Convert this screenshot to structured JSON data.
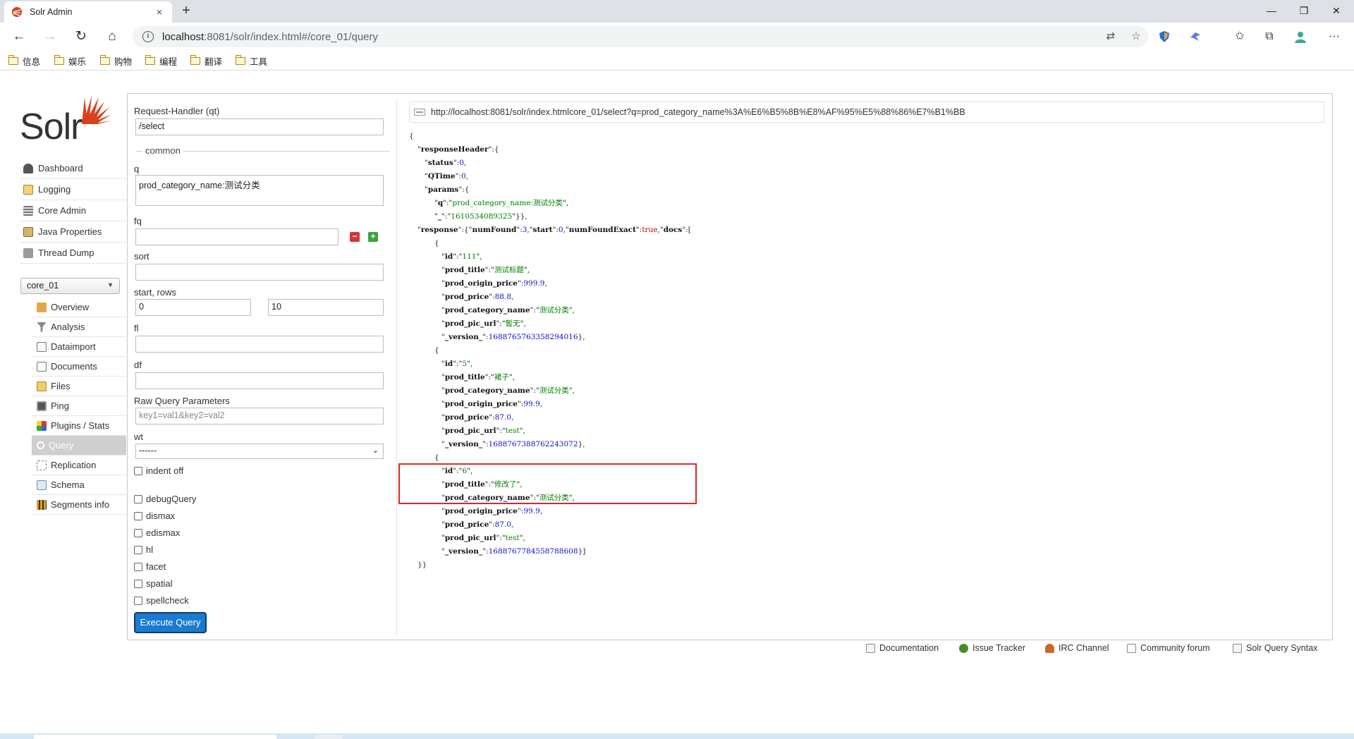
{
  "browser": {
    "tab_title": "Solr Admin",
    "tab_close": "×",
    "new_tab": "+",
    "win_min": "—",
    "win_max": "❐",
    "win_close": "✕",
    "back": "←",
    "forward": "→",
    "reload": "↻",
    "home": "⌂",
    "url_host": "localhost",
    "url_path": ":8081/solr/index.html#/core_01/query",
    "bookmarks": [
      "信息",
      "娱乐",
      "购物",
      "编程",
      "翻译",
      "工具"
    ]
  },
  "logo_text": "Solr",
  "nav": {
    "items": [
      "Dashboard",
      "Logging",
      "Core Admin",
      "Java Properties",
      "Thread Dump"
    ],
    "core_selected": "core_01",
    "core_items": [
      "Overview",
      "Analysis",
      "Dataimport",
      "Documents",
      "Files",
      "Ping",
      "Plugins / Stats",
      "Query",
      "Replication",
      "Schema",
      "Segments info"
    ]
  },
  "form": {
    "request_handler_label": "Request-Handler (qt)",
    "request_handler_value": "/select",
    "common_label": "common",
    "q_label": "q",
    "q_value": "prod_category_name:测试分类",
    "fq_label": "fq",
    "fq_value": "",
    "fq_remove": "−",
    "fq_add": "+",
    "sort_label": "sort",
    "sort_value": "",
    "start_rows_label": "start, rows",
    "start_value": "0",
    "rows_value": "10",
    "fl_label": "fl",
    "fl_value": "",
    "df_label": "df",
    "df_value": "",
    "raw_label": "Raw Query Parameters",
    "raw_placeholder": "key1=val1&key2=val2",
    "wt_label": "wt",
    "wt_value": "------",
    "indent_label": "indent off",
    "options": [
      "debugQuery",
      "dismax",
      "edismax",
      "hl",
      "facet",
      "spatial",
      "spellcheck"
    ],
    "execute_label": "Execute Query"
  },
  "result": {
    "request_url": "http://localhost:8081/solr/index.htmlcore_01/select?q=prod_category_name%3A%E6%B5%8B%E8%AF%95%E5%88%86%E7%B1%BB",
    "responseHeader": {
      "status": "0",
      "QTime": "0",
      "q": "prod_category_name:测试分类",
      "_": "1610534089325"
    },
    "numFound": "3",
    "start": "0",
    "numFoundExact": "true",
    "docs": [
      {
        "id": "111",
        "prod_title": "测试标题",
        "prod_origin_price": "999.9",
        "prod_price": "88.8",
        "prod_category_name": "测试分类",
        "prod_pic_url": "暂无",
        "_version_": "1688765763358294016"
      },
      {
        "id": "5",
        "prod_title": "裙子",
        "prod_category_name": "测试分类",
        "prod_origin_price": "99.9",
        "prod_price": "87.0",
        "prod_pic_url": "test",
        "_version_": "1688767388762243072"
      },
      {
        "id": "6",
        "prod_title": "修改了",
        "prod_category_name": "测试分类",
        "prod_origin_price": "99.9",
        "prod_price": "87.0",
        "prod_pic_url": "test",
        "_version_": "1688767784558788608"
      }
    ]
  },
  "footer": [
    "Documentation",
    "Issue Tracker",
    "IRC Channel",
    "Community forum",
    "Solr Query Syntax"
  ],
  "colors": {
    "accent": "#1a7bd0",
    "highlight": "#e2242c",
    "json_string": "#008000",
    "json_number": "#1010d0",
    "json_bool": "#c00000"
  }
}
